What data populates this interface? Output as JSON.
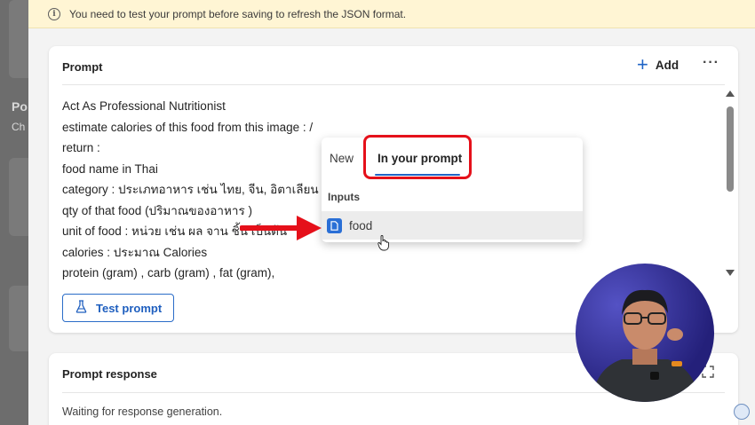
{
  "banner": {
    "text": "You need to test your prompt before saving to refresh the JSON format."
  },
  "background": {
    "fragment_1": "Po",
    "fragment_2": "Ch"
  },
  "prompt_card": {
    "title": "Prompt",
    "add_label": "Add",
    "more_label": "···",
    "lines": [
      "Act As Professional Nutritionist",
      "estimate calories of this food from this image :   /",
      "return :",
      "food name in Thai",
      "category : ประเภทอาหาร เช่น ไทย, จีน, อิตาเลียน เป็นต้น",
      "qty of that food (ปริมาณของอาหาร )",
      "unit of food : หน่วย เช่น ผล จาน ชิ้น เป็นต้น",
      "calories : ประมาณ Calories",
      "protein (gram) , carb (gram) , fat (gram),"
    ],
    "test_button_label": "Test prompt"
  },
  "insert_popup": {
    "tab_new": "New",
    "tab_in_prompt": "In your prompt",
    "section_label": "Inputs",
    "items": [
      {
        "label": "food",
        "icon": "document-icon"
      }
    ]
  },
  "response_card": {
    "title": "Prompt response",
    "status": "Waiting for response generation."
  },
  "colors": {
    "accent": "#1f64c6",
    "annotation_red": "#e5101a",
    "banner_bg": "#fff5d4"
  }
}
